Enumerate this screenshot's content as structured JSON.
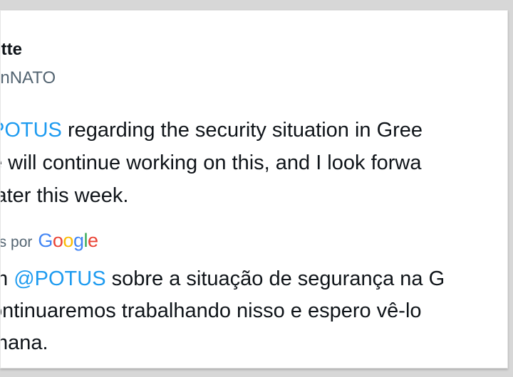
{
  "post": {
    "author_name": "utte",
    "author_handle": "enNATO",
    "original_text": {
      "line1": {
        "mention": "POTUS",
        "rest": " regarding the security situation in Gree"
      },
      "line2": "e will continue working on this, and I look forwa",
      "line3": "later this week."
    },
    "translation_label": "ês por",
    "translation_provider": [
      "G",
      "o",
      "o",
      "g",
      "l",
      "e"
    ],
    "translated_text": {
      "line1": {
        "pre": "m ",
        "mention": "@POTUS",
        "rest": " sobre a situação de segurança na G"
      },
      "line2": "ontinuaremos trabalhando nisso e espero vê-lo",
      "line3": "mana."
    }
  },
  "colors": {
    "mention": "#1d9bf0",
    "text": "#0f1419",
    "secondary": "#536471",
    "google_blue": "#4285F4",
    "google_red": "#EA4335",
    "google_yellow": "#FBBC05",
    "google_green": "#34A853"
  }
}
